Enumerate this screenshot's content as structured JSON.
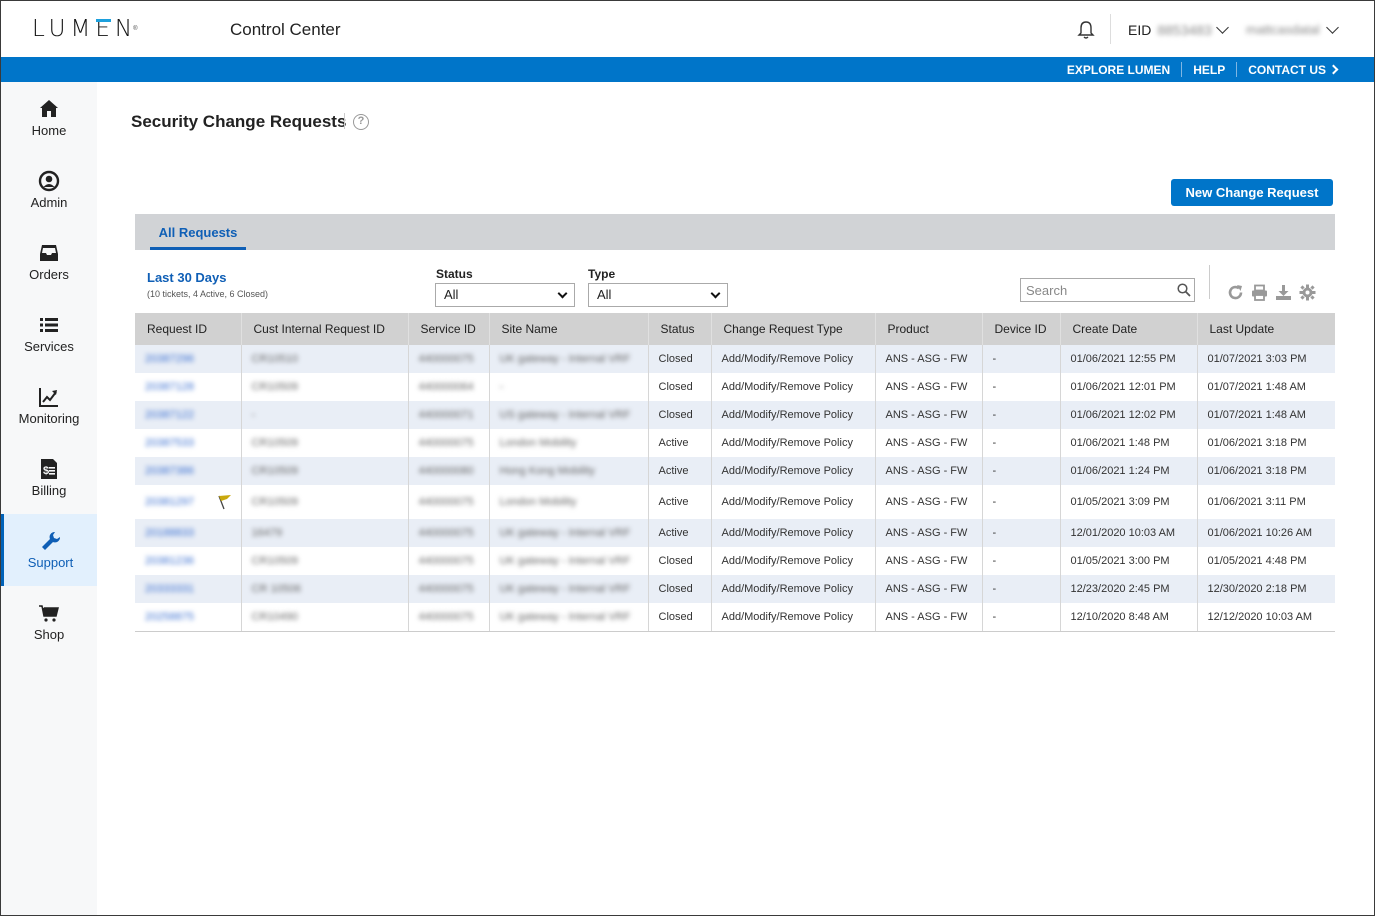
{
  "header": {
    "logo": "LUMEN",
    "app_title": "Control Center",
    "eid_label": "EID",
    "eid_value": "8853483",
    "user_name": "mattcasdatal"
  },
  "utility_links": [
    "EXPLORE LUMEN",
    "HELP",
    "CONTACT US"
  ],
  "sidebar": {
    "items": [
      {
        "label": "Home",
        "icon": "home-icon"
      },
      {
        "label": "Admin",
        "icon": "user-circle-icon"
      },
      {
        "label": "Orders",
        "icon": "inbox-icon"
      },
      {
        "label": "Services",
        "icon": "list-icon"
      },
      {
        "label": "Monitoring",
        "icon": "chart-line-icon"
      },
      {
        "label": "Billing",
        "icon": "invoice-icon"
      },
      {
        "label": "Support",
        "icon": "wrench-icon",
        "active": true
      },
      {
        "label": "Shop",
        "icon": "cart-icon"
      }
    ]
  },
  "page": {
    "title": "Security Change Requests",
    "help_glyph": "?",
    "new_button": "New Change Request",
    "tab": "All Requests",
    "range_label": "Last 30 Days",
    "range_summary": "(10 tickets, 4 Active, 6 Closed)",
    "filters": {
      "status_label": "Status",
      "status_value": "All",
      "type_label": "Type",
      "type_value": "All"
    },
    "search_placeholder": "Search"
  },
  "table": {
    "columns": [
      "Request ID",
      "Cust Internal Request ID",
      "Service ID",
      "Site Name",
      "Status",
      "Change Request Type",
      "Product",
      "Device ID",
      "Create Date",
      "Last Update"
    ],
    "rows": [
      {
        "id": "20387296",
        "cust": "CR10510",
        "service": "440000075",
        "site": "UK gateway - Internal VRF",
        "status": "Closed",
        "type": "Add/Modify/Remove Policy",
        "product": "ANS - ASG - FW",
        "device": "-",
        "created": "01/06/2021 12:55 PM",
        "updated": "01/07/2021 3:03 PM"
      },
      {
        "id": "20387128",
        "cust": "CR10509",
        "service": "440000064",
        "site": "-",
        "status": "Closed",
        "type": "Add/Modify/Remove Policy",
        "product": "ANS - ASG - FW",
        "device": "-",
        "created": "01/06/2021 12:01 PM",
        "updated": "01/07/2021 1:48 AM"
      },
      {
        "id": "20387122",
        "cust": "-",
        "service": "440000071",
        "site": "US gateway - Internal VRF",
        "status": "Closed",
        "type": "Add/Modify/Remove Policy",
        "product": "ANS - ASG - FW",
        "device": "-",
        "created": "01/06/2021 12:02 PM",
        "updated": "01/07/2021 1:48 AM"
      },
      {
        "id": "20387533",
        "cust": "CR10509",
        "service": "440000075",
        "site": "London Mobility",
        "status": "Active",
        "type": "Add/Modify/Remove Policy",
        "product": "ANS - ASG - FW",
        "device": "-",
        "created": "01/06/2021 1:48 PM",
        "updated": "01/06/2021 3:18 PM"
      },
      {
        "id": "20387386",
        "cust": "CR10509",
        "service": "440000080",
        "site": "Hong Kong Mobility",
        "status": "Active",
        "type": "Add/Modify/Remove Policy",
        "product": "ANS - ASG - FW",
        "device": "-",
        "created": "01/06/2021 1:24 PM",
        "updated": "01/06/2021 3:18 PM"
      },
      {
        "id": "20381297",
        "cust": "CR10509",
        "service": "440000075",
        "site": "London Mobility",
        "status": "Active",
        "type": "Add/Modify/Remove Policy",
        "product": "ANS - ASG - FW",
        "device": "-",
        "created": "01/05/2021 3:09 PM",
        "updated": "01/06/2021 3:11 PM",
        "flagged": true
      },
      {
        "id": "20188833",
        "cust": "16479",
        "service": "440000075",
        "site": "UK gateway - Internal VRF",
        "status": "Active",
        "type": "Add/Modify/Remove Policy",
        "product": "ANS - ASG - FW",
        "device": "-",
        "created": "12/01/2020 10:03 AM",
        "updated": "01/06/2021 10:26 AM"
      },
      {
        "id": "20381236",
        "cust": "CR10509",
        "service": "440000075",
        "site": "UK gateway - Internal VRF",
        "status": "Closed",
        "type": "Add/Modify/Remove Policy",
        "product": "ANS - ASG - FW",
        "device": "-",
        "created": "01/05/2021 3:00 PM",
        "updated": "01/05/2021 4:48 PM"
      },
      {
        "id": "20333331",
        "cust": "CR 10506",
        "service": "440000075",
        "site": "UK gateway - Internal VRF",
        "status": "Closed",
        "type": "Add/Modify/Remove Policy",
        "product": "ANS - ASG - FW",
        "device": "-",
        "created": "12/23/2020 2:45 PM",
        "updated": "12/30/2020 2:18 PM"
      },
      {
        "id": "20258875",
        "cust": "CR10490",
        "service": "440000075",
        "site": "UK gateway - Internal VRF",
        "status": "Closed",
        "type": "Add/Modify/Remove Policy",
        "product": "ANS - ASG - FW",
        "device": "-",
        "created": "12/10/2020 8:48 AM",
        "updated": "12/12/2020 10:03 AM"
      }
    ]
  },
  "colors": {
    "brand_blue": "#0075c9",
    "link_blue": "#0f5fb6",
    "flag": "#c9a80d",
    "row_alt": "#e9eef6"
  }
}
